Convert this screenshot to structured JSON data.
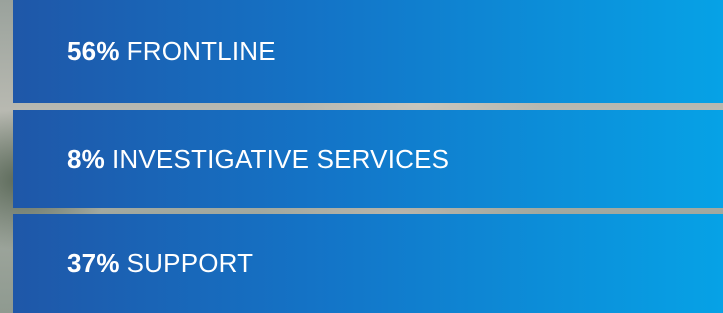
{
  "stats": [
    {
      "percent": "56%",
      "label": "FRONTLINE"
    },
    {
      "percent": "8%",
      "label": "INVESTIGATIVE SERVICES"
    },
    {
      "percent": "37%",
      "label": "SUPPORT"
    }
  ]
}
